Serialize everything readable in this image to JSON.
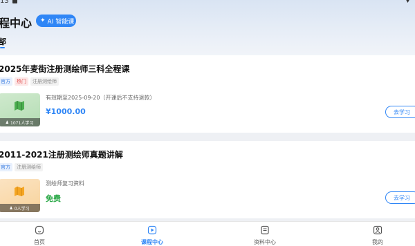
{
  "status": {
    "time": "13"
  },
  "header": {
    "title": "程中心",
    "ai_badge": "AI 智能课",
    "tab_all": "部"
  },
  "courses": [
    {
      "title": "2025年麦街注册测绘师三科全程课",
      "tags": [
        "官方",
        "热门",
        "注册测绘师"
      ],
      "subtitle": "有效期至2025-09-20（开课后不支持退款）",
      "price": "¥1000.00",
      "learners": "1071人学习",
      "button": "去学习"
    },
    {
      "title": "2011-2021注册测绘师真题讲解",
      "tags": [
        "官方",
        "注册测绘师"
      ],
      "subtitle": "测绘师复习资料",
      "price": "免费",
      "learners": "0人学习",
      "button": "去学习"
    }
  ],
  "nav": [
    {
      "label": "首页",
      "icon": "home-icon"
    },
    {
      "label": "课程中心",
      "icon": "course-play-icon",
      "active": true
    },
    {
      "label": "资料中心",
      "icon": "document-icon"
    },
    {
      "label": "我的",
      "icon": "profile-icon"
    }
  ],
  "colors": {
    "accent": "#2f86f6",
    "free": "#28a745",
    "hot_tag": "#e04a4a"
  }
}
